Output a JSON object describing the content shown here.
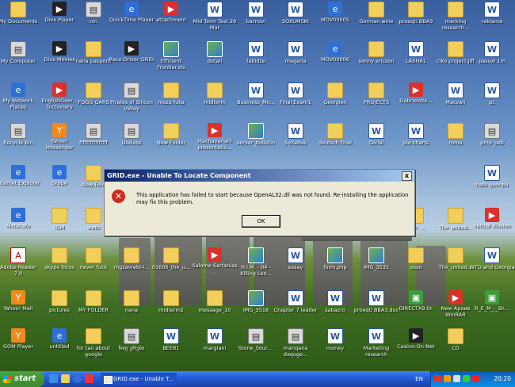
{
  "desktop": {
    "icons": [
      {
        "label": "My Documents",
        "glyph": "folder"
      },
      {
        "label": "Divx Player",
        "glyph": "dark"
      },
      {
        "label": "nin",
        "glyph": "gray"
      },
      {
        "label": "QuickTime Player",
        "glyph": "blue"
      },
      {
        "label": "attachment",
        "glyph": "red"
      },
      {
        "label": "Mid Term Test 29 Mar",
        "glyph": "word"
      },
      {
        "label": "barnovi",
        "glyph": "word"
      },
      {
        "label": "SOXUMSKI",
        "glyph": "word"
      },
      {
        "label": "MOV00005",
        "glyph": "blue"
      },
      {
        "label": "German wine",
        "glyph": "folder"
      },
      {
        "label": "proeqti BBA3",
        "glyph": "folder"
      },
      {
        "label": "marking research...",
        "glyph": "folder"
      },
      {
        "label": "reklama",
        "glyph": "word"
      },
      {
        "label": "My Computer",
        "glyph": "gray"
      },
      {
        "label": "Divx Movies",
        "glyph": "dark"
      },
      {
        "label": "nana pasporti",
        "glyph": "folder"
      },
      {
        "label": "Race Driver GRID",
        "glyph": "dark"
      },
      {
        "label": "Efficient Frontier.xls",
        "glyph": "img"
      },
      {
        "label": "detail",
        "glyph": "img"
      },
      {
        "label": "fabidze",
        "glyph": "word"
      },
      {
        "label": "magaria",
        "glyph": "word"
      },
      {
        "label": "MOV00006",
        "glyph": "blue"
      },
      {
        "label": "sonny ericson",
        "glyph": "folder"
      },
      {
        "label": "LASHA1",
        "glyph": "word"
      },
      {
        "label": "ciko project.jiff",
        "glyph": "folder"
      },
      {
        "label": "pasuxi 1m",
        "glyph": "word"
      },
      {
        "label": "My Network Places",
        "glyph": "blue"
      },
      {
        "label": "EnglishGeor... Dictionary",
        "glyph": "red"
      },
      {
        "label": "FOGO GARS",
        "glyph": "folder"
      },
      {
        "label": "Pirates of Silicon Valley",
        "glyph": "gray"
      },
      {
        "label": "moza fuka",
        "glyph": "folder"
      },
      {
        "label": "midterm",
        "glyph": "folder"
      },
      {
        "label": "Business_Mo...",
        "glyph": "word"
      },
      {
        "label": "Final Exam1",
        "glyph": "word"
      },
      {
        "label": "Georgien",
        "glyph": "folder"
      },
      {
        "label": "PROJECTS",
        "glyph": "folder"
      },
      {
        "label": "Gabrieldze...",
        "glyph": "red"
      },
      {
        "label": "Macvari",
        "glyph": "word"
      },
      {
        "label": "pc",
        "glyph": "word"
      },
      {
        "label": "Recycle Bin",
        "glyph": "gray"
      },
      {
        "label": "Yahoo! Messenger",
        "glyph": "orange"
      },
      {
        "label": "ffffffffffffffff",
        "glyph": "gray"
      },
      {
        "label": "Useless",
        "glyph": "gray"
      },
      {
        "label": "New Folder",
        "glyph": "folder"
      },
      {
        "label": "Machavariani presentatio...",
        "glyph": "red"
      },
      {
        "label": "server_bulletin",
        "glyph": "img"
      },
      {
        "label": "Syllabus",
        "glyph": "word"
      },
      {
        "label": "deutsch final",
        "glyph": "folder"
      },
      {
        "label": "fairial",
        "glyph": "word"
      },
      {
        "label": "pie charts",
        "glyph": "word"
      },
      {
        "label": "roma",
        "glyph": "folder"
      },
      {
        "label": "pmp_usb",
        "glyph": "gray"
      },
      {
        "label": "Internet Explorer",
        "glyph": "blue"
      },
      {
        "label": "Skype",
        "glyph": "blue"
      },
      {
        "label": "New Fold",
        "glyph": "folder"
      },
      {
        "label": "nato georgia",
        "glyph": "word"
      },
      {
        "label": "Metacafe",
        "glyph": "blue"
      },
      {
        "label": "IGM",
        "glyph": "folder"
      },
      {
        "label": "wetb",
        "glyph": "folder"
      },
      {
        "label": "kobakhidze",
        "glyph": "word"
      },
      {
        "label": "...sh_...",
        "glyph": "folder"
      },
      {
        "label": "The_united...",
        "glyph": "folder"
      },
      {
        "label": "optical illusion",
        "glyph": "red"
      },
      {
        "label": "Adobe Reader 7.0",
        "glyph": "pdf"
      },
      {
        "label": "skype fotos",
        "glyph": "folder"
      },
      {
        "label": "never fuck",
        "glyph": "folder"
      },
      {
        "label": "mgzavrebi-l...",
        "glyph": "folder"
      },
      {
        "label": "01606_the_u...",
        "glyph": "folder"
      },
      {
        "label": "Salome Sartanias ...",
        "glyph": "red"
      },
      {
        "label": "H.I.M. - 04 - Killing Lon...",
        "glyph": "img"
      },
      {
        "label": "essay",
        "glyph": "word"
      },
      {
        "label": "form.php",
        "glyph": "img"
      },
      {
        "label": "IMG_3531",
        "glyph": "img"
      },
      {
        "label": "soso",
        "glyph": "folder"
      },
      {
        "label": "The_united...",
        "glyph": "folder"
      },
      {
        "label": "WTO and Georgia",
        "glyph": "word"
      },
      {
        "label": "Yahoo! Mail",
        "glyph": "orange"
      },
      {
        "label": "pictures",
        "glyph": "folder"
      },
      {
        "label": "MY FOLDER",
        "glyph": "folder"
      },
      {
        "label": "nana",
        "glyph": "folder"
      },
      {
        "label": "midterm2",
        "glyph": "folder"
      },
      {
        "label": "message_10",
        "glyph": "folder"
      },
      {
        "label": "IMG_3518",
        "glyph": "img"
      },
      {
        "label": "Chapter 7 leader",
        "glyph": "word"
      },
      {
        "label": "sabazro",
        "glyph": "word"
      },
      {
        "label": "proeqti BBA3.doc",
        "glyph": "word"
      },
      {
        "label": "DIRECTX9.0c",
        "glyph": "green"
      },
      {
        "label": "New Архив WinRAR",
        "glyph": "red"
      },
      {
        "label": "R_E_M_-_Sh...",
        "glyph": "green"
      },
      {
        "label": "GOM Player",
        "glyph": "orange"
      },
      {
        "label": "untitled",
        "glyph": "blue"
      },
      {
        "label": "for tao about google",
        "glyph": "folder"
      },
      {
        "label": "ჩიფ ერები",
        "glyph": "gray"
      },
      {
        "label": "BEER1",
        "glyph": "word"
      },
      {
        "label": "margiani",
        "glyph": "word"
      },
      {
        "label": "Stone_Sour....",
        "glyph": "gray"
      },
      {
        "label": "manqana daqoge...",
        "glyph": "gray"
      },
      {
        "label": "money",
        "glyph": "word"
      },
      {
        "label": "Marketing research",
        "glyph": "word"
      },
      {
        "label": "Casino-On-Net",
        "glyph": "dark"
      },
      {
        "label": "CD",
        "glyph": "folder"
      }
    ]
  },
  "dialog": {
    "title": "GRID.exe - Unable To Locate Component",
    "message": "This application has failed to start because OpenAL32.dll was not found. Re-installing the application may fix this problem.",
    "ok_label": "OK",
    "close_label": "x",
    "error_glyph": "✕"
  },
  "taskbar": {
    "start_label": "start",
    "task_label": "GRID.exe - Unable T...",
    "language": "EN",
    "clock": "20:20"
  }
}
